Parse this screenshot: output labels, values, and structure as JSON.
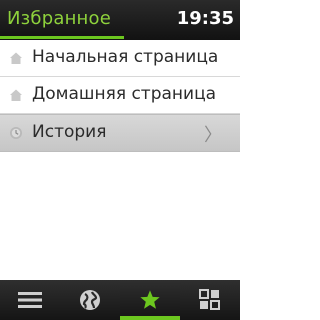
{
  "header": {
    "title": "Избранное",
    "clock": "19:35"
  },
  "list": {
    "items": [
      {
        "label": "Начальная страница",
        "icon": "home-icon"
      },
      {
        "label": "Домашняя страница",
        "icon": "home-icon"
      },
      {
        "label": "История",
        "icon": "history-icon",
        "chevron": "〉",
        "selected": true
      }
    ]
  },
  "toolbar": {
    "tabs": [
      {
        "icon": "menu-icon"
      },
      {
        "icon": "globe-icon"
      },
      {
        "icon": "star-icon",
        "active": true
      },
      {
        "icon": "apps-icon"
      }
    ]
  },
  "colors": {
    "accent": "#6cc71f",
    "title_text": "#8ed23c",
    "bar_background": "#1a1a1a",
    "selected_row": "#cfcfcf"
  }
}
